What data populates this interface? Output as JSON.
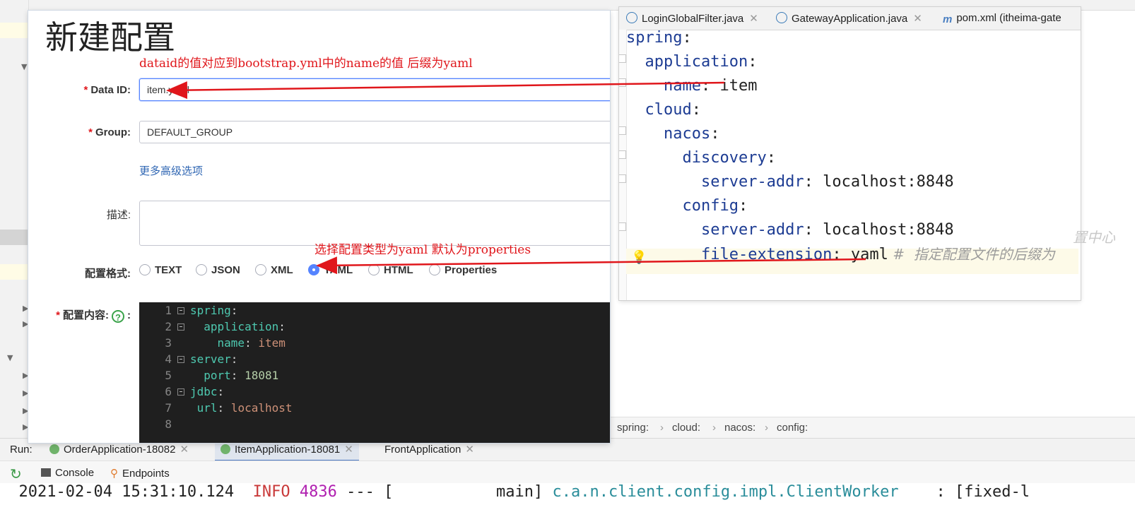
{
  "editor": {
    "tabs": [
      {
        "label": "LoginGlobalFilter.java",
        "icon": "java-class-icon"
      },
      {
        "label": "GatewayApplication.java",
        "icon": "java-class-icon"
      },
      {
        "label": "pom.xml (itheima-gate",
        "icon": "maven-icon"
      }
    ],
    "lines": [
      {
        "indent": 0,
        "key": "spring",
        "value": ""
      },
      {
        "indent": 1,
        "key": "application",
        "value": ""
      },
      {
        "indent": 2,
        "key": "name",
        "value": " item"
      },
      {
        "indent": 1,
        "key": "cloud",
        "value": ""
      },
      {
        "indent": 2,
        "key": "nacos",
        "value": ""
      },
      {
        "indent": 3,
        "key": "discovery",
        "value": ""
      },
      {
        "indent": 4,
        "key": "server-addr",
        "value": " localhost:8848"
      },
      {
        "indent": 3,
        "key": "config",
        "value": ""
      },
      {
        "indent": 4,
        "key": "server-addr",
        "value": " localhost:8848"
      },
      {
        "indent": 4,
        "key": "file-extension",
        "value": " yaml",
        "comment": " #  指定配置文件的后缀为"
      }
    ],
    "faint_right_text": "置中心"
  },
  "breadcrumb": [
    "spring:",
    "cloud:",
    "nacos:",
    "config:"
  ],
  "run": {
    "label": "Run:",
    "tabs": [
      {
        "label": "OrderApplication-18082",
        "active": false
      },
      {
        "label": "ItemApplication-18081",
        "active": true
      },
      {
        "label": "FrontApplication",
        "active": false
      }
    ]
  },
  "console": {
    "tabs": [
      "Console",
      "Endpoints"
    ],
    "log": {
      "timestamp": "2021-02-04 15:31:10.124",
      "level": "INFO",
      "pid": "4836",
      "sep": " --- [           main] ",
      "logger": "c.a.n.client.config.impl.ClientWorker",
      "tail": "    : [fixed-l"
    }
  },
  "dialog": {
    "title": "新建配置",
    "note_dataid": "dataid的值对应到bootstrap.yml中的name的值 后缀为yaml",
    "note_format": "选择配置类型为yaml 默认为properties",
    "data_id_label": "Data ID:",
    "data_id_value": "item.yaml",
    "group_label": "Group:",
    "group_value": "DEFAULT_GROUP",
    "advanced_link": "更多高级选项",
    "desc_label": "描述:",
    "format_label": "配置格式:",
    "formats": [
      "TEXT",
      "JSON",
      "XML",
      "YAML",
      "HTML",
      "Properties"
    ],
    "selected_format": "YAML",
    "content_label": "配置内容:",
    "content_colon": ":",
    "help_icon": "?",
    "code": [
      {
        "n": "1",
        "fold": true,
        "indent": "",
        "key": "spring",
        "val": "",
        "valtype": ""
      },
      {
        "n": "2",
        "fold": true,
        "indent": "  ",
        "key": "application",
        "val": "",
        "valtype": ""
      },
      {
        "n": "3",
        "fold": false,
        "indent": "    ",
        "key": "name",
        "val": "item",
        "valtype": "s"
      },
      {
        "n": "4",
        "fold": true,
        "indent": "",
        "key": "server",
        "val": "",
        "valtype": ""
      },
      {
        "n": "5",
        "fold": false,
        "indent": "  ",
        "key": "port",
        "val": "18081",
        "valtype": "n"
      },
      {
        "n": "6",
        "fold": true,
        "indent": "",
        "key": "jdbc",
        "val": "",
        "valtype": ""
      },
      {
        "n": "7",
        "fold": false,
        "indent": " ",
        "key": "url",
        "val": "localhost",
        "valtype": "s"
      },
      {
        "n": "8",
        "fold": false,
        "indent": "",
        "key": "",
        "val": "",
        "valtype": ""
      }
    ]
  },
  "colors": {
    "annotation_red": "#e0161b",
    "accent_blue": "#5584ff",
    "yaml_key": "#1d3c93"
  }
}
